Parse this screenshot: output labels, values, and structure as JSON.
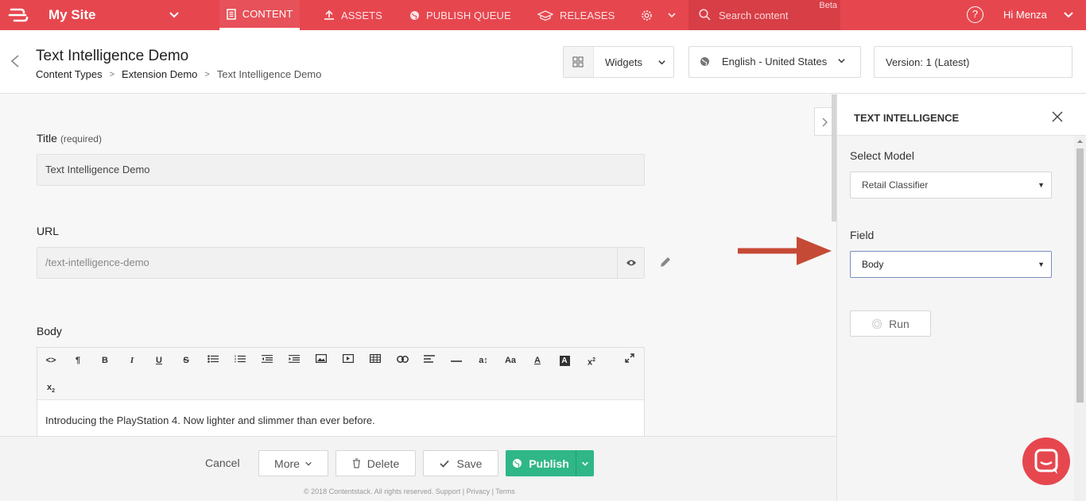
{
  "topnav": {
    "site_name": "My Site",
    "tabs": [
      {
        "label": "CONTENT",
        "active": true
      },
      {
        "label": "ASSETS"
      },
      {
        "label": "PUBLISH QUEUE"
      },
      {
        "label": "RELEASES"
      }
    ],
    "search_placeholder": "Search content",
    "search_badge": "Beta",
    "help_label": "?",
    "user_greeting": "Hi  Menza",
    "accent_color": "#e6474f"
  },
  "header": {
    "title": "Text Intelligence Demo",
    "breadcrumbs": [
      "Content Types",
      "Extension Demo",
      "Text Intelligence Demo"
    ],
    "widgets_label": "Widgets",
    "language_label": "English - United States",
    "version_label": "Version: 1 (Latest)"
  },
  "form": {
    "title_label": "Title",
    "title_required": "(required)",
    "title_value": "Text Intelligence Demo",
    "url_label": "URL",
    "url_value": "/text-intelligence-demo",
    "body_label": "Body",
    "body_text": "Introducing the PlayStation 4. Now lighter and slimmer than ever before."
  },
  "footer": {
    "cancel": "Cancel",
    "more": "More",
    "delete": "Delete",
    "save": "Save",
    "publish": "Publish",
    "copyright": "© 2018 Contentstack. All rights reserved. Support | Privacy | Terms",
    "publish_color": "#2fb787"
  },
  "panel": {
    "title": "TEXT INTELLIGENCE",
    "model_label": "Select Model",
    "model_value": "Retail Classifier",
    "field_label": "Field",
    "field_value": "Body",
    "run_label": "Run"
  }
}
